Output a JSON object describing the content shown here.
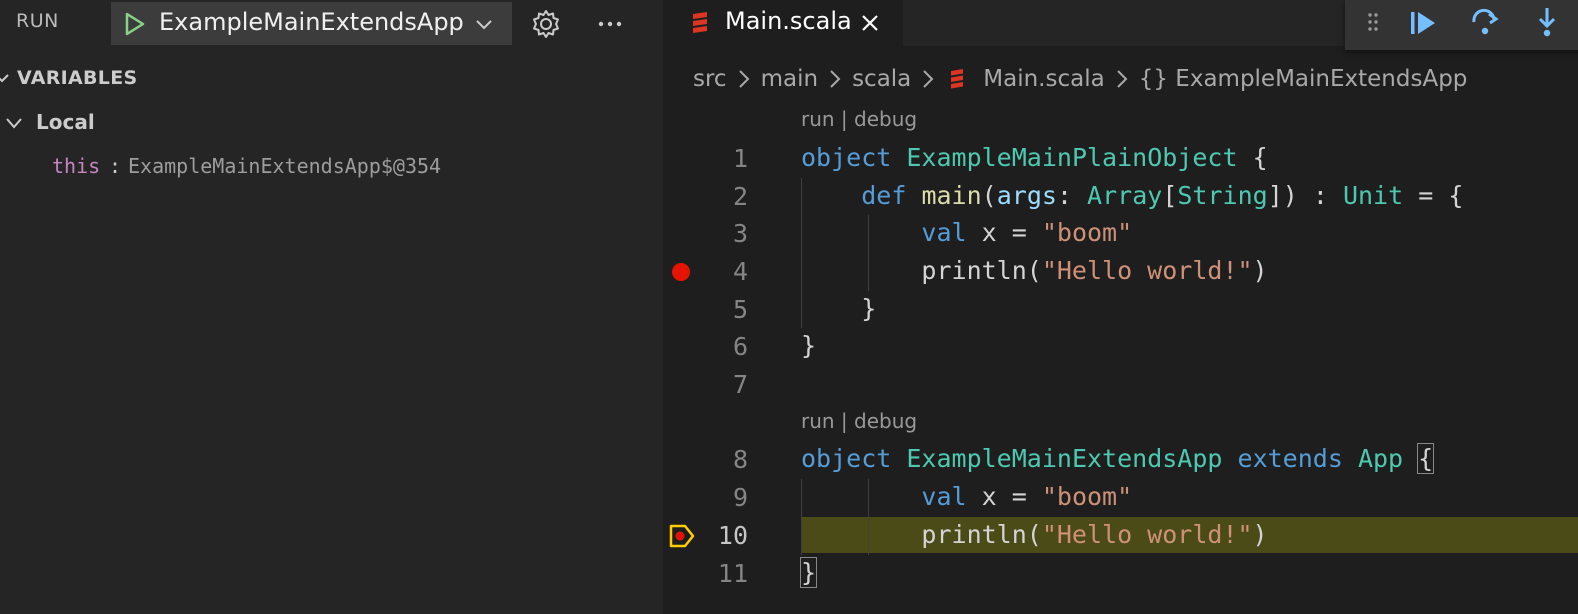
{
  "sidebar": {
    "run_label": "RUN",
    "config_name": "ExampleMainExtendsApp",
    "variables_title": "VARIABLES",
    "local_title": "Local",
    "variable": {
      "name": "this",
      "colon": ":",
      "value": "ExampleMainExtendsApp$@354"
    }
  },
  "editor": {
    "tab": {
      "label": "Main.scala"
    },
    "breadcrumb": [
      "src",
      "main",
      "scala",
      "Main.scala",
      "{} ExampleMainExtendsApp"
    ],
    "codelens": {
      "run": "run",
      "sep": " | ",
      "debug": "debug"
    },
    "line_numbers": [
      "1",
      "2",
      "3",
      "4",
      "5",
      "6",
      "7",
      "8",
      "9",
      "10",
      "11"
    ],
    "code": {
      "l1": [
        "object",
        " ",
        "ExampleMainPlainObject",
        " {"
      ],
      "l2": [
        "    ",
        "def",
        " ",
        "main",
        "(",
        "args",
        ": ",
        "Array",
        "[",
        "String",
        "]) : ",
        "Unit",
        " = {"
      ],
      "l3": [
        "        ",
        "val",
        " x = ",
        "\"boom\""
      ],
      "l4": [
        "        println(",
        "\"Hello world!\"",
        ")"
      ],
      "l5": [
        "    }"
      ],
      "l6": [
        "}"
      ],
      "l8": [
        "object",
        " ",
        "ExampleMainExtendsApp",
        " ",
        "extends",
        " ",
        "App",
        " ",
        "{"
      ],
      "l9": [
        "        ",
        "val",
        " x = ",
        "\"boom\""
      ],
      "l10": [
        "        println(",
        "\"Hello world!\"",
        ")"
      ],
      "l11": [
        "}"
      ]
    }
  },
  "colors": {
    "keyword": "#569cd6",
    "type": "#4ec9b0",
    "string": "#ce9178",
    "breakpoint": "#e51400",
    "current_line": "#4b4b18",
    "debug_icon": "#75beff"
  },
  "icons": [
    "play-icon",
    "chevron-down-icon",
    "gear-icon",
    "ellipsis-icon",
    "scala-file-icon",
    "close-icon",
    "drag-grip-icon",
    "continue-icon",
    "step-over-icon",
    "step-into-icon",
    "breakpoint-icon",
    "current-frame-icon"
  ]
}
